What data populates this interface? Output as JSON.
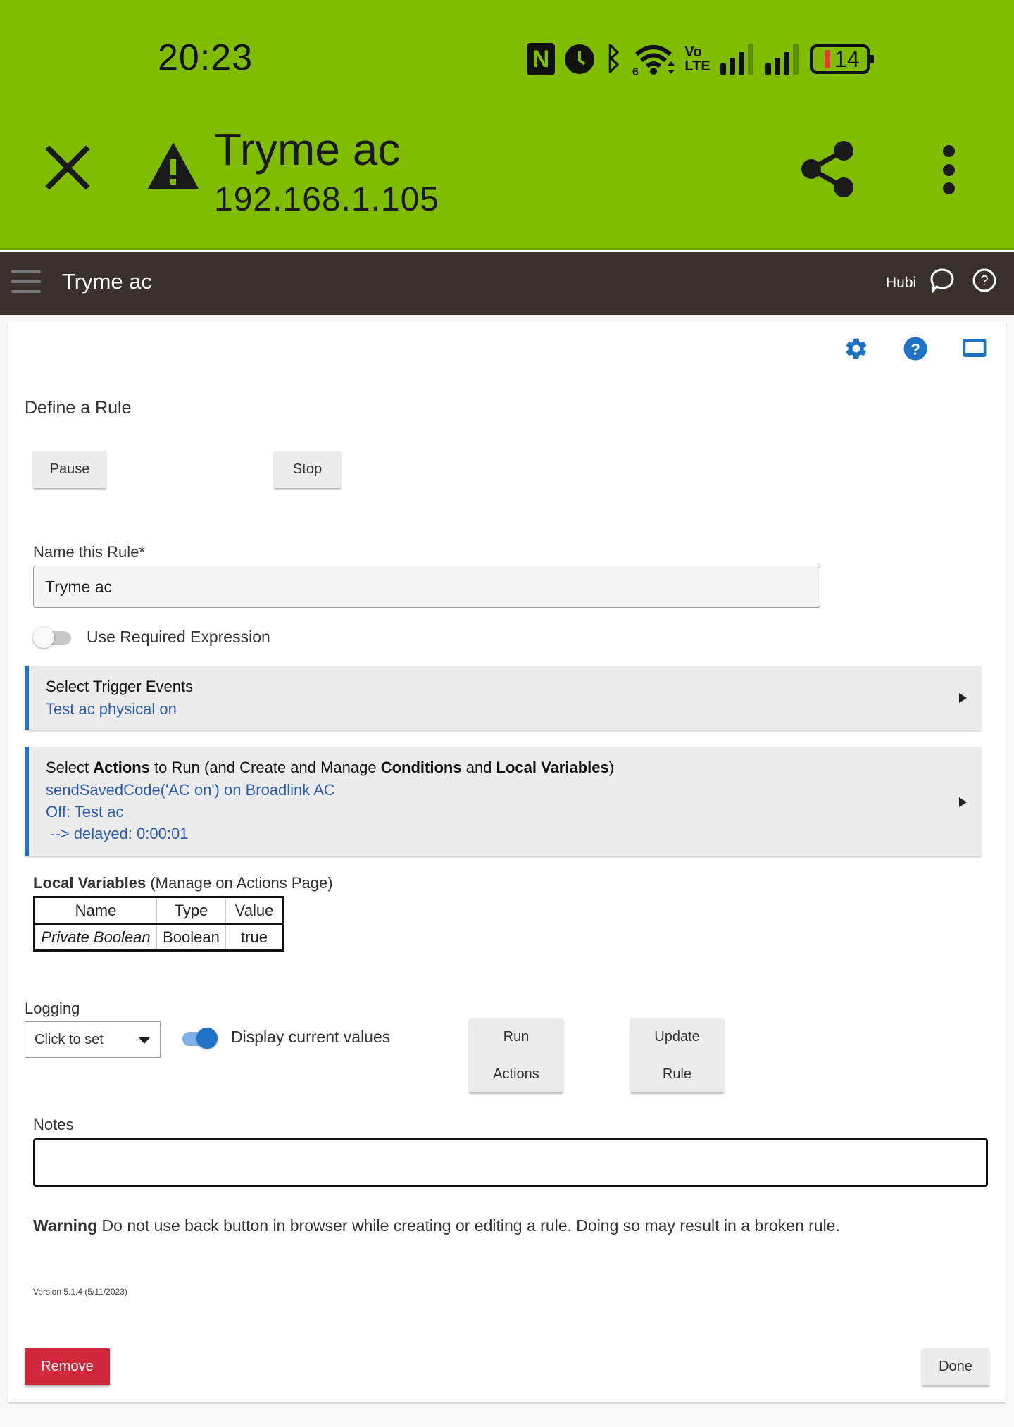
{
  "status_bar": {
    "time": "20:23",
    "icons": [
      "nfc-icon",
      "alarm-icon",
      "bluetooth-icon",
      "wifi6-icon",
      "volte-icon",
      "signal-icon",
      "signal-icon"
    ],
    "volte_label_top": "Vo",
    "volte_label_bottom": "LTE",
    "battery_level": "14",
    "battery_color": "#e63a3a"
  },
  "app_bar": {
    "title": "Tryme ac",
    "subtitle": "192.168.1.105",
    "background": "#80bd00"
  },
  "hub_header": {
    "title": "Tryme ac",
    "hub_name": "Hubi",
    "background": "#3a302d"
  },
  "card": {
    "icons": [
      "gear-icon",
      "help-icon",
      "display-icon"
    ],
    "accent": "#1e72c6",
    "section_title": "Define a Rule",
    "pause_label": "Pause",
    "stop_label": "Stop",
    "name_field": {
      "label": "Name this Rule*",
      "value": "Tryme ac"
    },
    "required_expression": {
      "label": "Use Required Expression",
      "on": false
    },
    "trigger": {
      "title": "Select Trigger Events",
      "lines": [
        "Test ac physical on"
      ]
    },
    "actions": {
      "title_parts": [
        {
          "text": "Select ",
          "bold": false
        },
        {
          "text": "Actions",
          "bold": true
        },
        {
          "text": " to Run (and Create and Manage ",
          "bold": false
        },
        {
          "text": "Conditions",
          "bold": true
        },
        {
          "text": " and ",
          "bold": false
        },
        {
          "text": "Local Variables",
          "bold": true
        },
        {
          "text": ")",
          "bold": false
        }
      ],
      "lines": [
        "sendSavedCode('AC on') on Broadlink AC",
        "Off: Test ac",
        " --> delayed: 0:00:01"
      ]
    },
    "local_variables": {
      "heading_bold": "Local Variables",
      "heading_rest": " (Manage on Actions Page)",
      "columns": [
        "Name",
        "Type",
        "Value"
      ],
      "rows": [
        {
          "name": "Private Boolean",
          "type": "Boolean",
          "value": "true"
        }
      ]
    },
    "logging": {
      "label": "Logging",
      "selected": "Click to set"
    },
    "display_current_values": {
      "label": "Display current values",
      "on": true
    },
    "run_actions_label_line1": "Run",
    "run_actions_label_line2": "Actions",
    "update_rule_label_line1": "Update",
    "update_rule_label_line2": "Rule",
    "notes": {
      "label": "Notes",
      "value": ""
    },
    "warning": {
      "bold": "Warning",
      "text": " Do not use back button in browser while creating or editing a rule. Doing so may result in a broken rule."
    },
    "version": "Version 5.1.4 (5/11/2023)",
    "remove_label": "Remove",
    "remove_color": "#d0283a",
    "done_label": "Done"
  }
}
